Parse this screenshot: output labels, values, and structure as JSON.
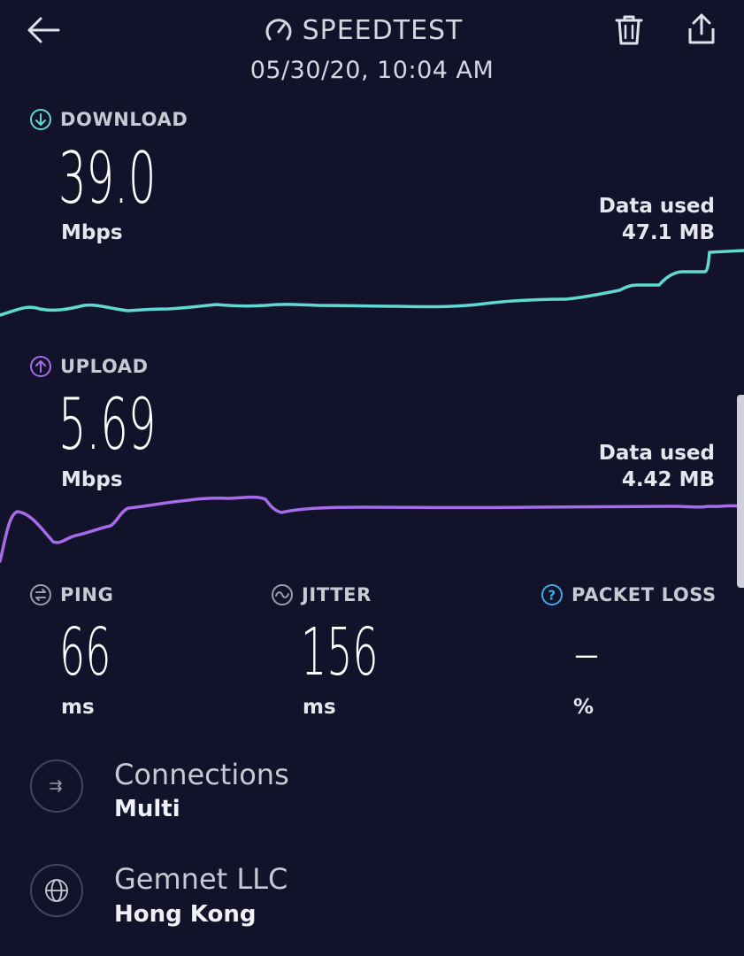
{
  "header": {
    "title": "SPEEDTEST",
    "timestamp": "05/30/20, 10:04 AM",
    "icons": {
      "back": "back-arrow-icon",
      "gauge": "speedometer-icon",
      "delete": "trash-icon",
      "share": "share-icon"
    }
  },
  "download": {
    "label": "DOWNLOAD",
    "value": "39.0",
    "unit": "Mbps",
    "data_used_label": "Data used",
    "data_used_value": "47.1 MB",
    "color": "#5fd9d2"
  },
  "upload": {
    "label": "UPLOAD",
    "value": "5.69",
    "unit": "Mbps",
    "data_used_label": "Data used",
    "data_used_value": "4.42 MB",
    "color": "#a56be8"
  },
  "ping": {
    "label": "PING",
    "value": "66",
    "unit": "ms"
  },
  "jitter": {
    "label": "JITTER",
    "value": "156",
    "unit": "ms"
  },
  "packet_loss": {
    "label": "PACKET LOSS",
    "value": "–",
    "unit": "%",
    "color": "#3fa8e6"
  },
  "connections": {
    "title": "Connections",
    "value": "Multi"
  },
  "server": {
    "title": "Gemnet LLC",
    "location": "Hong Kong"
  }
}
